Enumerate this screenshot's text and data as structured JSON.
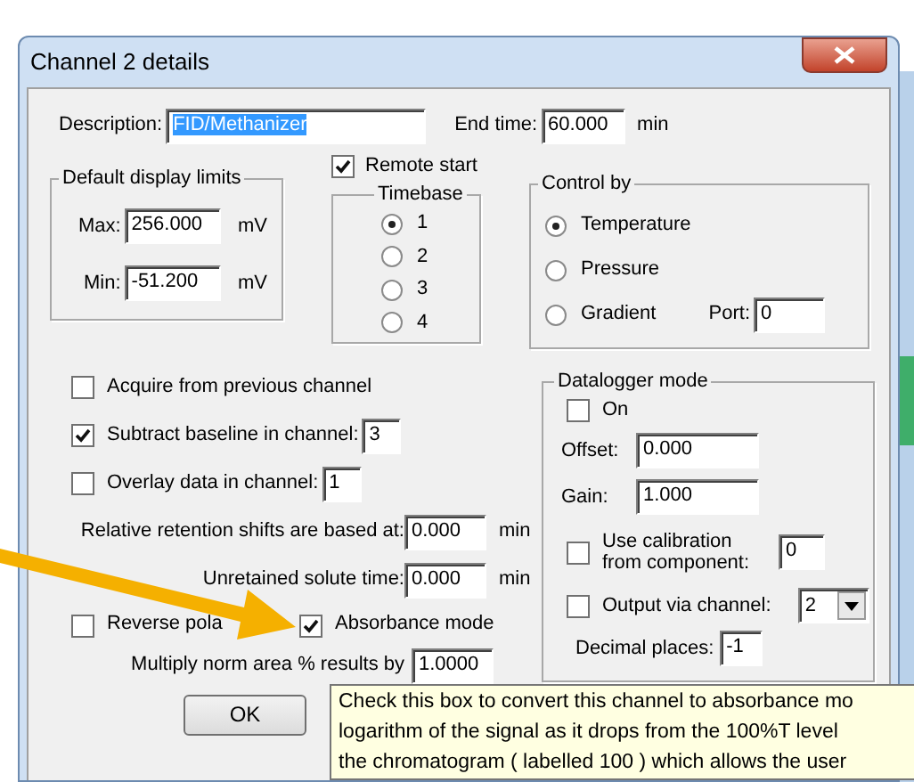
{
  "window": {
    "title": "Channel 2 details"
  },
  "description": {
    "label": "Description:",
    "value": "FID/Methanizer",
    "selected": true
  },
  "end_time": {
    "label": "End time:",
    "value": "60.000",
    "unit": "min"
  },
  "display_limits": {
    "title": "Default display limits",
    "fields": [
      {
        "label": "Max:",
        "value": "256.000",
        "unit": "mV"
      },
      {
        "label": "Min:",
        "value": "-51.200",
        "unit": "mV"
      }
    ]
  },
  "remote_start": {
    "label": "Remote start",
    "checked": true
  },
  "timebase": {
    "title": "Timebase",
    "options": [
      {
        "label": "1",
        "selected": true
      },
      {
        "label": "2",
        "selected": false
      },
      {
        "label": "3",
        "selected": false
      },
      {
        "label": "4",
        "selected": false
      }
    ]
  },
  "control_by": {
    "title": "Control by",
    "options": [
      {
        "label": "Temperature",
        "selected": true
      },
      {
        "label": "Pressure",
        "selected": false
      },
      {
        "label": "Gradient",
        "selected": false
      }
    ],
    "port": {
      "label": "Port:",
      "value": "0"
    }
  },
  "checks": [
    {
      "label": "Acquire from previous channel",
      "checked": false
    },
    {
      "label": "Subtract baseline in channel:",
      "checked": true,
      "value": "3"
    },
    {
      "label": "Overlay data in channel:",
      "checked": false,
      "value": "1"
    }
  ],
  "times": [
    {
      "label": "Relative retention shifts are based at:",
      "value": "0.000",
      "unit": "min"
    },
    {
      "label": "Unretained solute time:",
      "value": "0.000",
      "unit": "min"
    }
  ],
  "reverse_polarity": {
    "label": "Reverse pola",
    "checked": false
  },
  "absorbance_mode": {
    "label": "Absorbance mode",
    "checked": true
  },
  "multiply": {
    "label": "Multiply norm area % results by",
    "value": "1.0000"
  },
  "ok_button": "OK",
  "datalogger": {
    "title": "Datalogger mode",
    "on": {
      "label": "On",
      "checked": false
    },
    "fields": [
      {
        "label": "Offset:",
        "value": "0.000"
      },
      {
        "label": "Gain:",
        "value": "1.000"
      }
    ],
    "calibration": {
      "label": "Use calibration from component:",
      "checked": false,
      "value": "0"
    },
    "output": {
      "label": "Output via channel:",
      "checked": false,
      "value": "2"
    },
    "decimal": {
      "label": "Decimal places:",
      "value": "-1"
    }
  },
  "tooltip": {
    "lines": [
      "Check this box to convert this channel to absorbance mo",
      "logarithm of the signal as it drops from the 100%T level",
      "the chromatogram ( labelled 100 ) which allows the user"
    ]
  }
}
